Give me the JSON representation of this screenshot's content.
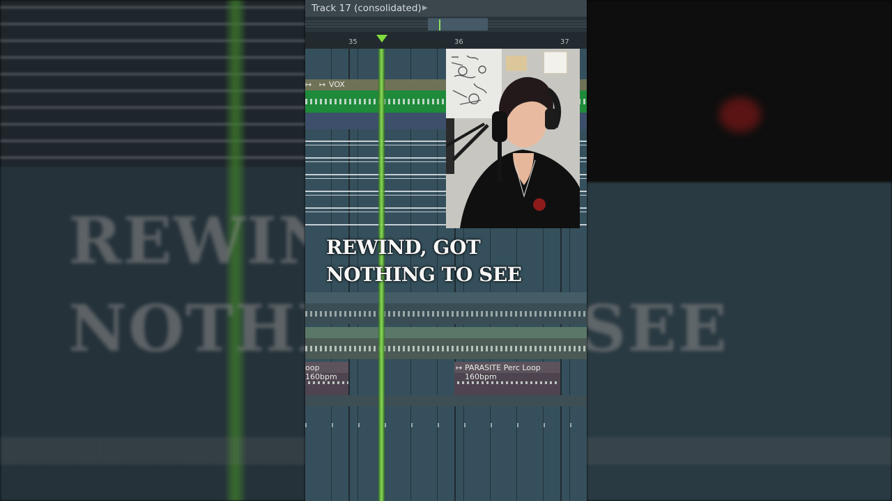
{
  "window": {
    "title": "Track 17 (consolidated)"
  },
  "ruler": {
    "bars": [
      "35",
      "36",
      "37"
    ]
  },
  "tracks": {
    "vox_label": "VOX",
    "perc_loop_left_label": "oop 160bpm",
    "perc_loop_right_label": "PARASITE Perc Loop 160bpm"
  },
  "lyrics": {
    "line1": "REWIND, GOT",
    "line2": "NOTHING TO SEE"
  },
  "background": {
    "blurred_line1": "REWIN",
    "blurred_line2": "NOTHI",
    "blurred_line2_end": "SEE"
  },
  "colors": {
    "playhead": "#8be052",
    "vox_track": "#1e8a3a",
    "grid": "#35505c"
  },
  "icons": {
    "clip_marker": "clip-arrow-icon",
    "title_arrow": "chevron-right-icon",
    "playhead_marker": "playhead-triangle-icon"
  }
}
